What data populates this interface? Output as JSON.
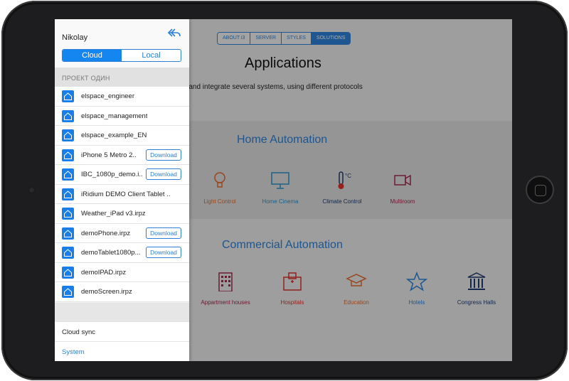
{
  "colors": {
    "accent": "#2c7fd4",
    "panel_bg": "#f4f4f4",
    "device": "#1d1d1f",
    "light_control": "#e0682d",
    "home_cinema": "#2c8ec8",
    "multiroom": "#a0284a",
    "hospitals": "#d9322b",
    "education": "#e0682d",
    "hotels": "#2c7fd4",
    "congress": "#1f3a6e"
  },
  "app": {
    "tabs": [
      "ABOUT i3",
      "SERVER",
      "STYLES",
      "SOLUTIONS"
    ],
    "title": "Applications",
    "description": "g and integrate several systems, using different protocols",
    "home_automation": {
      "title": "Home Automation",
      "items": [
        {
          "label": "Light Control",
          "icon": "bulb-icon"
        },
        {
          "label": "Home Cinema",
          "icon": "monitor-icon"
        },
        {
          "label": "Climate Control",
          "icon": "thermometer-icon"
        },
        {
          "label": "Multiroom",
          "icon": "camera-icon"
        }
      ]
    },
    "commercial_automation": {
      "title": "Commercial Automation",
      "items": [
        {
          "label": "Appartment houses",
          "icon": "building-icon"
        },
        {
          "label": "Hospitals",
          "icon": "hospital-icon"
        },
        {
          "label": "Education",
          "icon": "graduation-cap-icon"
        },
        {
          "label": "Hotels",
          "icon": "star-icon"
        },
        {
          "label": "Congress Halls",
          "icon": "columns-icon"
        }
      ]
    }
  },
  "panel": {
    "user_name": "Nikolay",
    "storage_tabs": {
      "cloud": "Cloud",
      "local": "Local",
      "selected": "Cloud"
    },
    "project_header": "ПРОЕКТ ОДИН",
    "files": [
      {
        "name": "elspace_engineer",
        "download": ""
      },
      {
        "name": "elspace_management",
        "download": ""
      },
      {
        "name": "elspace_example_EN",
        "download": ""
      },
      {
        "name": "iPhone 5 Metro 2..",
        "download": "Download"
      },
      {
        "name": "IBC_1080p_demo.i..",
        "download": "Download"
      },
      {
        "name": "iRidium DEMO Client Tablet ..",
        "download": ""
      },
      {
        "name": "Weather_iPad v3.irpz",
        "download": ""
      },
      {
        "name": "demoPhone.irpz",
        "download": "Download"
      },
      {
        "name": "demoTablet1080p...",
        "download": "Download"
      },
      {
        "name": "demoIPAD.irpz",
        "download": ""
      },
      {
        "name": "demoScreen.irpz",
        "download": ""
      }
    ],
    "cloud_sync": "Cloud sync",
    "system": "System"
  }
}
